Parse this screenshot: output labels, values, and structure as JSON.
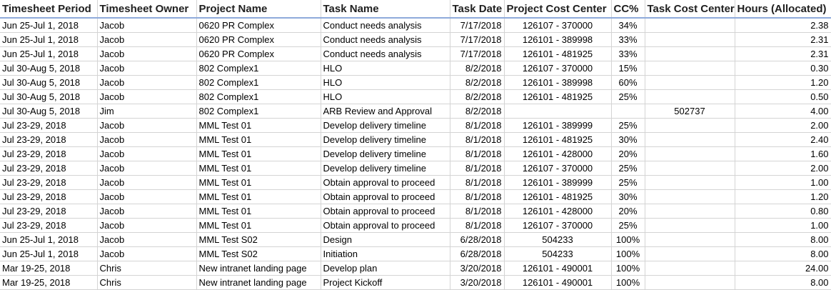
{
  "headers": [
    "Timesheet Period",
    "Timesheet Owner",
    "Project Name",
    "Task Name",
    "Task Date",
    "Project Cost Center",
    "CC%",
    "Task Cost Center",
    "Hours (Allocated)"
  ],
  "rows": [
    [
      "Jun 25-Jul 1, 2018",
      "Jacob",
      "0620 PR Complex",
      "Conduct needs analysis",
      "7/17/2018",
      "126107 - 370000",
      "34%",
      "",
      "2.38"
    ],
    [
      "Jun 25-Jul 1, 2018",
      "Jacob",
      "0620 PR Complex",
      "Conduct needs analysis",
      "7/17/2018",
      "126101 - 389998",
      "33%",
      "",
      "2.31"
    ],
    [
      "Jun 25-Jul 1, 2018",
      "Jacob",
      "0620 PR Complex",
      "Conduct needs analysis",
      "7/17/2018",
      "126101 - 481925",
      "33%",
      "",
      "2.31"
    ],
    [
      "Jul 30-Aug 5, 2018",
      "Jacob",
      "802 Complex1",
      "HLO",
      "8/2/2018",
      "126107 - 370000",
      "15%",
      "",
      "0.30"
    ],
    [
      "Jul 30-Aug 5, 2018",
      "Jacob",
      "802 Complex1",
      "HLO",
      "8/2/2018",
      "126101 - 389998",
      "60%",
      "",
      "1.20"
    ],
    [
      "Jul 30-Aug 5, 2018",
      "Jacob",
      "802 Complex1",
      "HLO",
      "8/2/2018",
      "126101 - 481925",
      "25%",
      "",
      "0.50"
    ],
    [
      "Jul 30-Aug 5, 2018",
      "Jim",
      "802 Complex1",
      "ARB Review and Approval",
      "8/2/2018",
      "",
      "",
      "502737",
      "4.00"
    ],
    [
      "Jul 23-29, 2018",
      "Jacob",
      "MML Test 01",
      "Develop delivery timeline",
      "8/1/2018",
      "126101 - 389999",
      "25%",
      "",
      "2.00"
    ],
    [
      "Jul 23-29, 2018",
      "Jacob",
      "MML Test 01",
      "Develop delivery timeline",
      "8/1/2018",
      "126101 - 481925",
      "30%",
      "",
      "2.40"
    ],
    [
      "Jul 23-29, 2018",
      "Jacob",
      "MML Test 01",
      "Develop delivery timeline",
      "8/1/2018",
      "126101 - 428000",
      "20%",
      "",
      "1.60"
    ],
    [
      "Jul 23-29, 2018",
      "Jacob",
      "MML Test 01",
      "Develop delivery timeline",
      "8/1/2018",
      "126107 - 370000",
      "25%",
      "",
      "2.00"
    ],
    [
      "Jul 23-29, 2018",
      "Jacob",
      "MML Test 01",
      "Obtain approval to proceed",
      "8/1/2018",
      "126101 - 389999",
      "25%",
      "",
      "1.00"
    ],
    [
      "Jul 23-29, 2018",
      "Jacob",
      "MML Test 01",
      "Obtain approval to proceed",
      "8/1/2018",
      "126101 - 481925",
      "30%",
      "",
      "1.20"
    ],
    [
      "Jul 23-29, 2018",
      "Jacob",
      "MML Test 01",
      "Obtain approval to proceed",
      "8/1/2018",
      "126101 - 428000",
      "20%",
      "",
      "0.80"
    ],
    [
      "Jul 23-29, 2018",
      "Jacob",
      "MML Test 01",
      "Obtain approval to proceed",
      "8/1/2018",
      "126107 - 370000",
      "25%",
      "",
      "1.00"
    ],
    [
      "Jun 25-Jul 1, 2018",
      "Jacob",
      "MML Test S02",
      "Design",
      "6/28/2018",
      "504233",
      "100%",
      "",
      "8.00"
    ],
    [
      "Jun 25-Jul 1, 2018",
      "Jacob",
      "MML Test S02",
      "Initiation",
      "6/28/2018",
      "504233",
      "100%",
      "",
      "8.00"
    ],
    [
      "Mar 19-25, 2018",
      "Chris",
      "New intranet landing page",
      "Develop plan",
      "3/20/2018",
      "126101 - 490001",
      "100%",
      "",
      "24.00"
    ],
    [
      "Mar 19-25, 2018",
      "Chris",
      "New intranet landing page",
      "Project Kickoff",
      "3/20/2018",
      "126101 - 490001",
      "100%",
      "",
      "8.00"
    ]
  ]
}
